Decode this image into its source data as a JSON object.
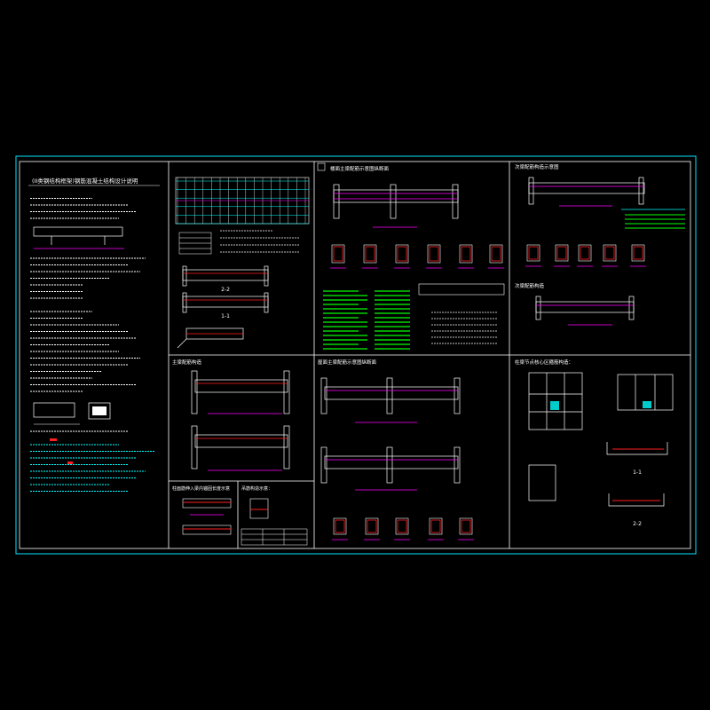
{
  "drawing": {
    "panels": [
      {
        "id": "general-notes",
        "title": "(II类钢结构框架)钢筋混凝土结构设计说明"
      },
      {
        "id": "section-2-2",
        "title": "2-2"
      },
      {
        "id": "section-1-1-top",
        "title": "1-1"
      },
      {
        "id": "beam-detail-top",
        "title": "楼面主梁配筋示意图纵断面"
      },
      {
        "id": "secondary-beam-top",
        "title": "次梁配筋构造示意图"
      },
      {
        "id": "secondary-beam-section",
        "title": "次梁配筋构造"
      },
      {
        "id": "beam-mid-left",
        "title": "主梁配筋构造"
      },
      {
        "id": "beam-mid-center",
        "title": "屋面主梁配筋示意图纵断面"
      },
      {
        "id": "column-joint",
        "title": "柱梁节点核心区箍筋构造："
      },
      {
        "id": "bottom-left-a",
        "title": "柱面筋伸入梁内锚固长度示意"
      },
      {
        "id": "bottom-left-b",
        "title": "吊筋构造示意："
      },
      {
        "id": "section-1-1",
        "title": "1-1"
      },
      {
        "id": "section-2-2-bottom",
        "title": "2-2"
      }
    ],
    "colors": {
      "background": "#000000",
      "frame": "#00e5ff",
      "white": "#ffffff",
      "magenta": "#ff00ff",
      "red": "#ff2020",
      "green": "#00ff00",
      "yellow": "#ffff00",
      "cyan": "#00ffff"
    }
  }
}
